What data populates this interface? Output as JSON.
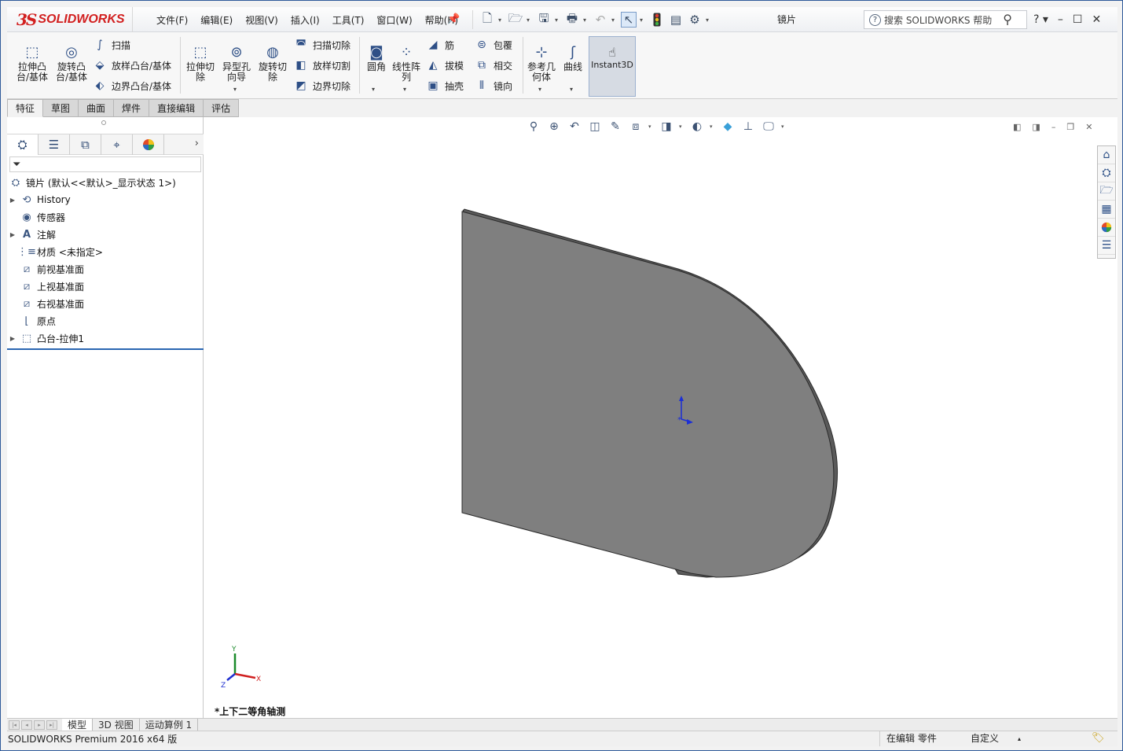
{
  "app": {
    "logo_prefix": "3S",
    "logo_name": "SOLIDWORKS",
    "document_title": "镜片"
  },
  "menus": [
    "文件(F)",
    "编辑(E)",
    "视图(V)",
    "插入(I)",
    "工具(T)",
    "窗口(W)",
    "帮助(H)"
  ],
  "search": {
    "placeholder": "搜索 SOLIDWORKS 帮助"
  },
  "ribbon": {
    "extrude_boss": "拉伸凸台/基体",
    "revolve_boss": "旋转凸台/基体",
    "sweep": "扫描",
    "loft_boss": "放样凸台/基体",
    "boundary_boss": "边界凸台/基体",
    "extrude_cut": "拉伸切除",
    "hole_wizard": "异型孔向导",
    "revolve_cut": "旋转切除",
    "swept_cut": "扫描切除",
    "lofted_cut": "放样切割",
    "boundary_cut": "边界切除",
    "fillet": "圆角",
    "linear_pattern": "线性阵列",
    "rib": "筋",
    "draft": "拔模",
    "shell": "抽壳",
    "wrap": "包覆",
    "intersect": "相交",
    "mirror": "镜向",
    "ref_geometry": "参考几何体",
    "curves": "曲线",
    "instant3d": "Instant3D"
  },
  "command_tabs": [
    "特征",
    "草图",
    "曲面",
    "焊件",
    "直接编辑",
    "评估"
  ],
  "feature_tree": {
    "root": "镜片 (默认<<默认>_显示状态 1>)",
    "items": [
      {
        "label": "History",
        "icon": "history-icon",
        "expandable": true
      },
      {
        "label": "传感器",
        "icon": "sensor-icon",
        "expandable": false
      },
      {
        "label": "注解",
        "icon": "annotation-icon",
        "expandable": true
      },
      {
        "label": "材质 <未指定>",
        "icon": "material-icon",
        "expandable": false
      },
      {
        "label": "前视基准面",
        "icon": "plane-icon",
        "expandable": false
      },
      {
        "label": "上视基准面",
        "icon": "plane-icon",
        "expandable": false
      },
      {
        "label": "右视基准面",
        "icon": "plane-icon",
        "expandable": false
      },
      {
        "label": "原点",
        "icon": "origin-icon",
        "expandable": false
      },
      {
        "label": "凸台-拉伸1",
        "icon": "extrude-feature-icon",
        "expandable": true
      }
    ]
  },
  "viewport": {
    "view_name": "*上下二等角轴测",
    "part_color": "#7f7f7f",
    "triad_labels": {
      "x": "X",
      "y": "Y",
      "z": "Z"
    }
  },
  "bottom_tabs": [
    "模型",
    "3D 视图",
    "运动算例 1"
  ],
  "status": {
    "product": "SOLIDWORKS Premium 2016 x64 版",
    "editing": "在编辑 零件",
    "units": "自定义"
  }
}
